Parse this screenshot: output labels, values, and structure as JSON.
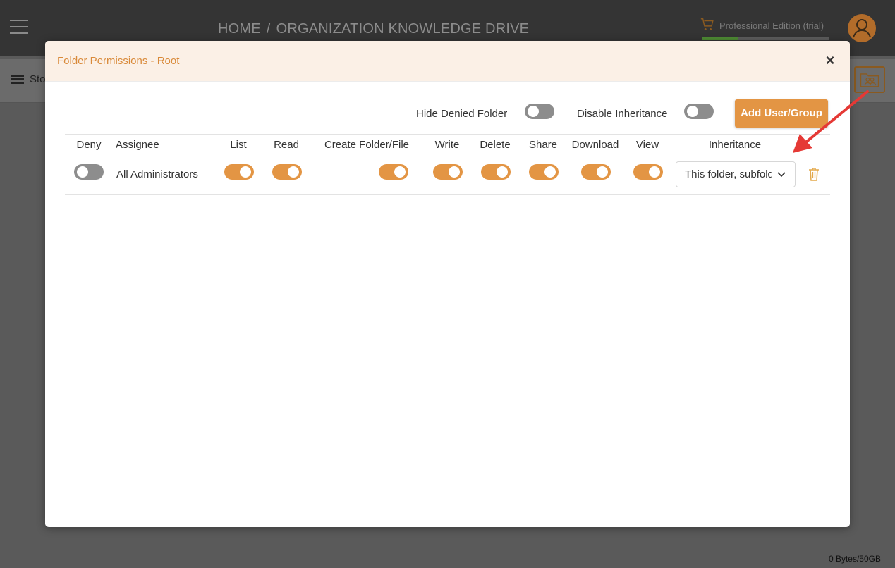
{
  "app": {
    "breadcrumb": [
      "HOME",
      "ORGANIZATION KNOWLEDGE DRIVE"
    ],
    "breadcrumb_sep": "/",
    "edition_label": "Professional Edition (trial)",
    "edition_progress": 0.28,
    "store_label": "Sto",
    "storage_usage": "0 Bytes/50GB",
    "accent_color": "#e39544",
    "icons": [
      "menu-icon",
      "cart-icon",
      "user-avatar-icon",
      "folder-users-icon",
      "chevron-down-icon",
      "trash-icon",
      "close-icon",
      "list-icon"
    ]
  },
  "modal": {
    "title": "Folder Permissions - Root",
    "close": "×",
    "hide_denied_label": "Hide Denied Folder",
    "hide_denied_on": false,
    "disable_inheritance_label": "Disable Inheritance",
    "disable_inheritance_on": false,
    "add_button": "Add User/Group"
  },
  "table": {
    "columns": {
      "deny": "Deny",
      "assignee": "Assignee",
      "list": "List",
      "read": "Read",
      "create": "Create Folder/File",
      "write": "Write",
      "delete": "Delete",
      "share": "Share",
      "download": "Download",
      "view": "View",
      "inheritance": "Inheritance"
    },
    "rows": [
      {
        "assignee": "All Administrators",
        "deny": false,
        "list": true,
        "read": true,
        "create": true,
        "write": true,
        "delete": true,
        "share": true,
        "download": true,
        "view": true,
        "inheritance": "This folder, subfolders and files"
      }
    ]
  }
}
